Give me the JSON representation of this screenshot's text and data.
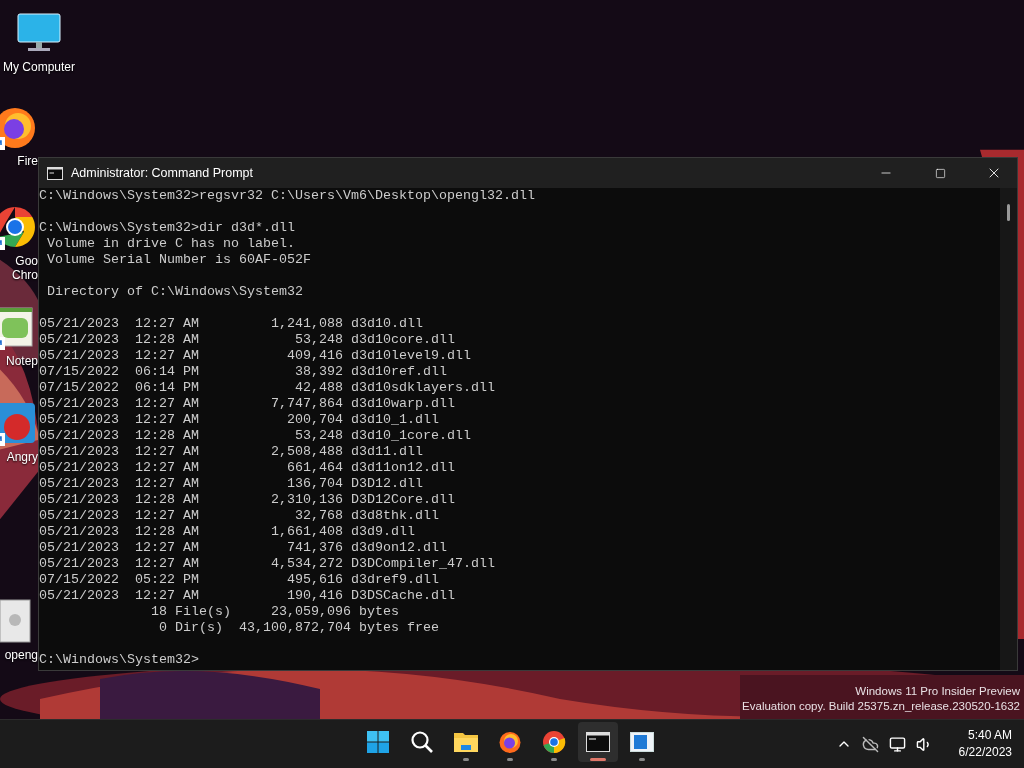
{
  "desktop_icons": [
    {
      "kind": "computer",
      "label": "My Computer",
      "shortcut": false,
      "clipped": false
    },
    {
      "kind": "firefox",
      "label": "Fire",
      "shortcut": true,
      "clipped": true
    },
    {
      "kind": "chrome",
      "label": "Goo Chro",
      "shortcut": true,
      "clipped": true
    },
    {
      "kind": "notepad",
      "label": "Notep",
      "shortcut": true,
      "clipped": true
    },
    {
      "kind": "game",
      "label": "Angry",
      "shortcut": true,
      "clipped": true
    },
    {
      "kind": "dll",
      "label": "openg",
      "shortcut": false,
      "clipped": true
    }
  ],
  "window": {
    "title": "Administrator: Command Prompt",
    "console_blocks": [
      [
        "C:\\Windows\\System32>regsvr32 C:\\Users\\Vm6\\Desktop\\opengl32.dll"
      ],
      [
        "C:\\Windows\\System32>dir d3d*.dll",
        " Volume in drive C has no label.",
        " Volume Serial Number is 60AF-052F"
      ],
      [
        " Directory of C:\\Windows\\System32"
      ],
      [
        "05/21/2023  12:27 AM         1,241,088 d3d10.dll",
        "05/21/2023  12:28 AM            53,248 d3d10core.dll",
        "05/21/2023  12:27 AM           409,416 d3d10level9.dll",
        "07/15/2022  06:14 PM            38,392 d3d10ref.dll",
        "07/15/2022  06:14 PM            42,488 d3d10sdklayers.dll",
        "05/21/2023  12:27 AM         7,747,864 d3d10warp.dll",
        "05/21/2023  12:27 AM           200,704 d3d10_1.dll",
        "05/21/2023  12:28 AM            53,248 d3d10_1core.dll",
        "05/21/2023  12:27 AM         2,508,488 d3d11.dll",
        "05/21/2023  12:27 AM           661,464 d3d11on12.dll",
        "05/21/2023  12:27 AM           136,704 D3D12.dll",
        "05/21/2023  12:28 AM         2,310,136 D3D12Core.dll",
        "05/21/2023  12:27 AM            32,768 d3d8thk.dll",
        "05/21/2023  12:28 AM         1,661,408 d3d9.dll",
        "05/21/2023  12:27 AM           741,376 d3d9on12.dll",
        "05/21/2023  12:27 AM         4,534,272 D3DCompiler_47.dll",
        "07/15/2022  05:22 PM           495,616 d3dref9.dll",
        "05/21/2023  12:27 AM           190,416 D3DSCache.dll",
        "              18 File(s)     23,059,096 bytes",
        "               0 Dir(s)  43,100,872,704 bytes free"
      ],
      [
        "C:\\Windows\\System32>"
      ]
    ]
  },
  "watermark": [
    "Windows 11 Pro Insider Preview",
    "Evaluation copy. Build 25375.zn_release.230520-1632"
  ],
  "taskbar": {
    "items": [
      {
        "kind": "start",
        "running": false,
        "selected": false
      },
      {
        "kind": "search",
        "running": false,
        "selected": false
      },
      {
        "kind": "files",
        "running": true,
        "selected": false
      },
      {
        "kind": "firefox",
        "running": true,
        "selected": false
      },
      {
        "kind": "chrome",
        "running": true,
        "selected": false
      },
      {
        "kind": "terminal",
        "running": true,
        "selected": true
      },
      {
        "kind": "app",
        "running": true,
        "selected": false
      }
    ],
    "time": "5:40 AM",
    "date": "6/22/2023"
  }
}
